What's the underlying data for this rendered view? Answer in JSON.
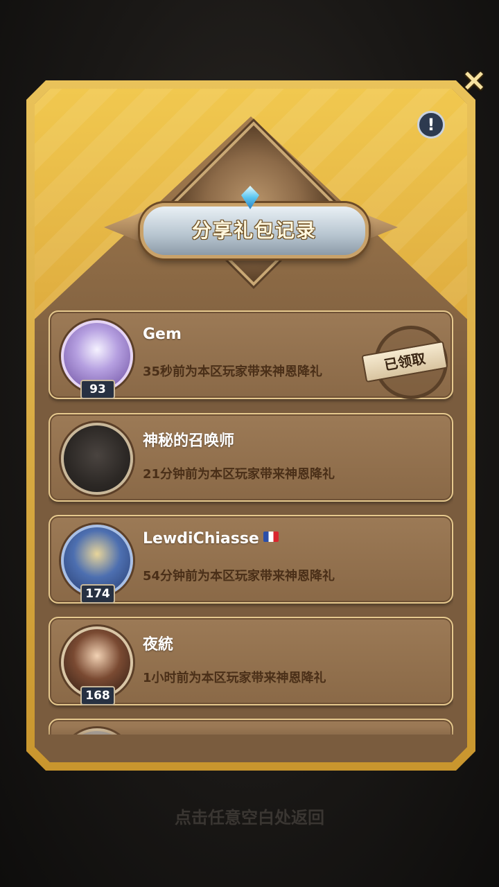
{
  "dialog": {
    "title": "分享礼包记录",
    "close_label": "×",
    "info_label": "!"
  },
  "records": [
    {
      "name": "Gem",
      "level": "93",
      "message": "35秒前为本区玩家带来神恩降礼",
      "status": "已领取",
      "avatar": "purple-hair-hero"
    },
    {
      "name": "神秘的召唤师",
      "level": "",
      "message": "21分钟前为本区玩家带来神恩降礼",
      "status": "",
      "avatar": "silhouette"
    },
    {
      "name": "LewdiChiasse",
      "level": "174",
      "message": "54分钟前为本区玩家带来神恩降礼",
      "status": "",
      "avatar": "armored-hero",
      "flag": "france-flag-icon"
    },
    {
      "name": "夜統",
      "level": "168",
      "message": "1小时前为本区玩家带来神恩降礼",
      "status": "",
      "avatar": "dark-hair-hero"
    },
    {
      "name": "",
      "level": "",
      "message": "",
      "status": "",
      "avatar": "winter-hat-hero"
    }
  ],
  "hint": "点击任意空白处返回"
}
